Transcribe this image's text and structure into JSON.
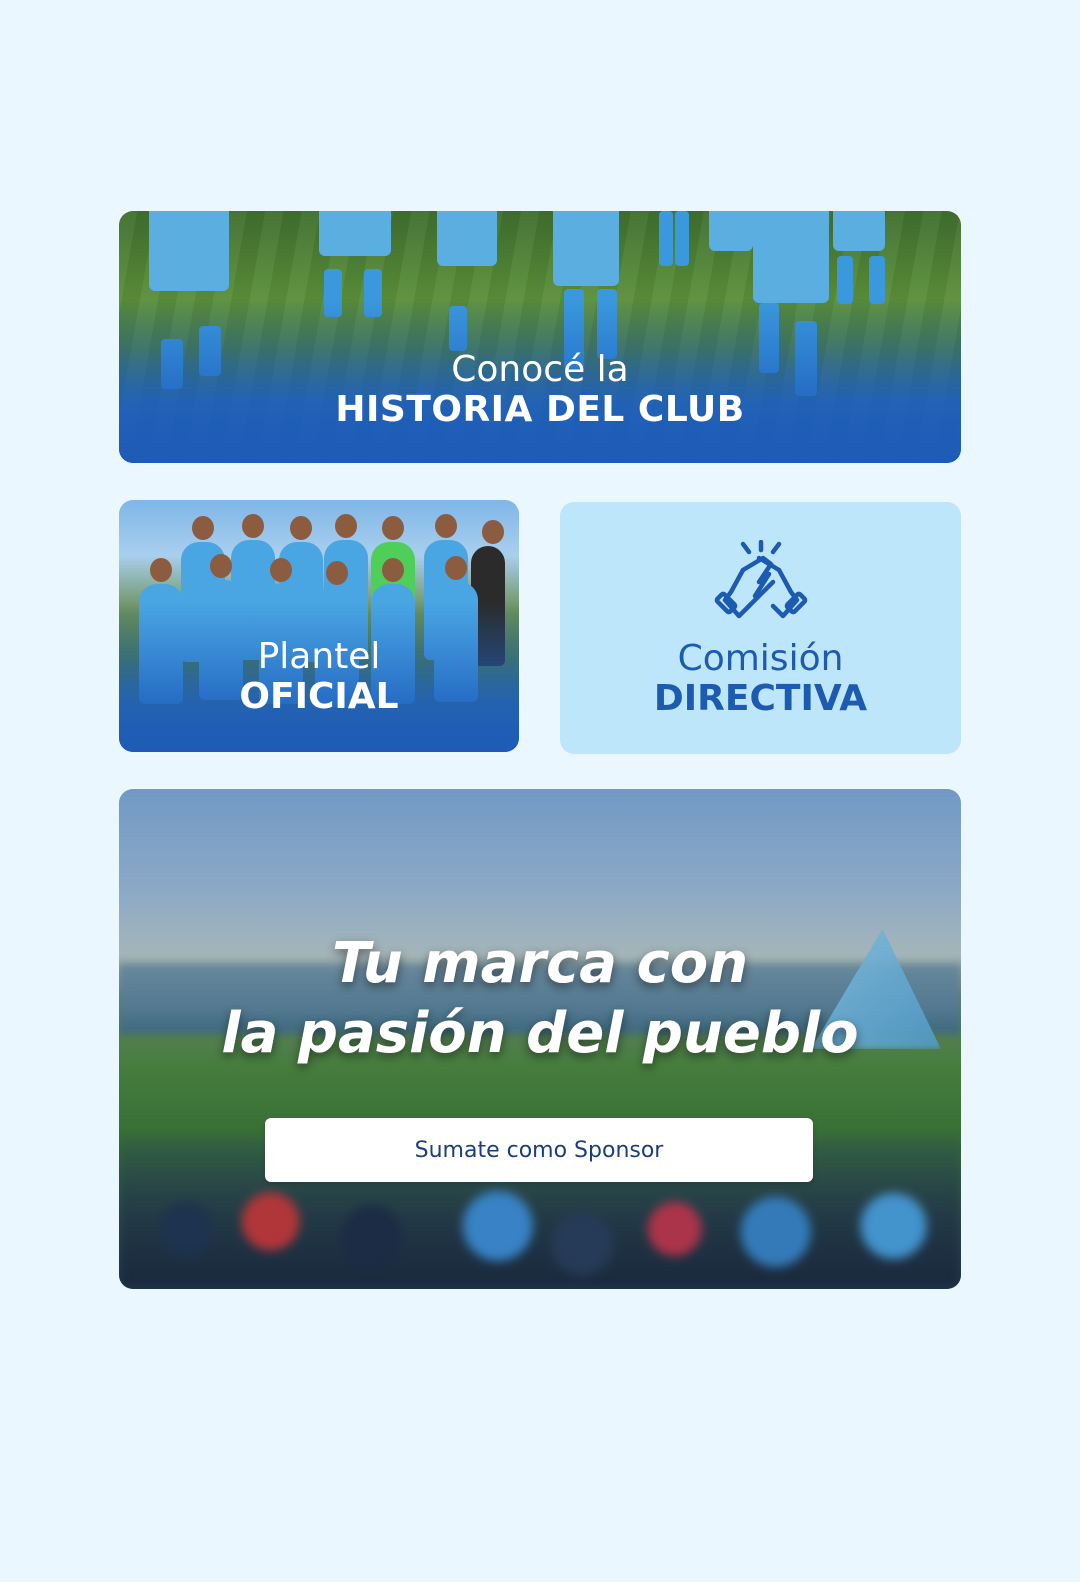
{
  "historia": {
    "line1": "Conocé la",
    "line2": "HISTORIA DEL CLUB"
  },
  "plantel": {
    "line1": "Plantel",
    "line2": "OFICIAL"
  },
  "comision": {
    "line1": "Comisión",
    "line2": "DIRECTIVA",
    "icon": "handshake-icon"
  },
  "sponsor": {
    "headline_line1": "Tu marca con",
    "headline_line2": "la pasión del pueblo",
    "cta_label": "Sumate como Sponsor"
  },
  "colors": {
    "background": "#eaf7fe",
    "brand_blue": "#1c5bb0",
    "light_blue_card": "#bde6fb",
    "cta_text": "#1a3f7a"
  }
}
